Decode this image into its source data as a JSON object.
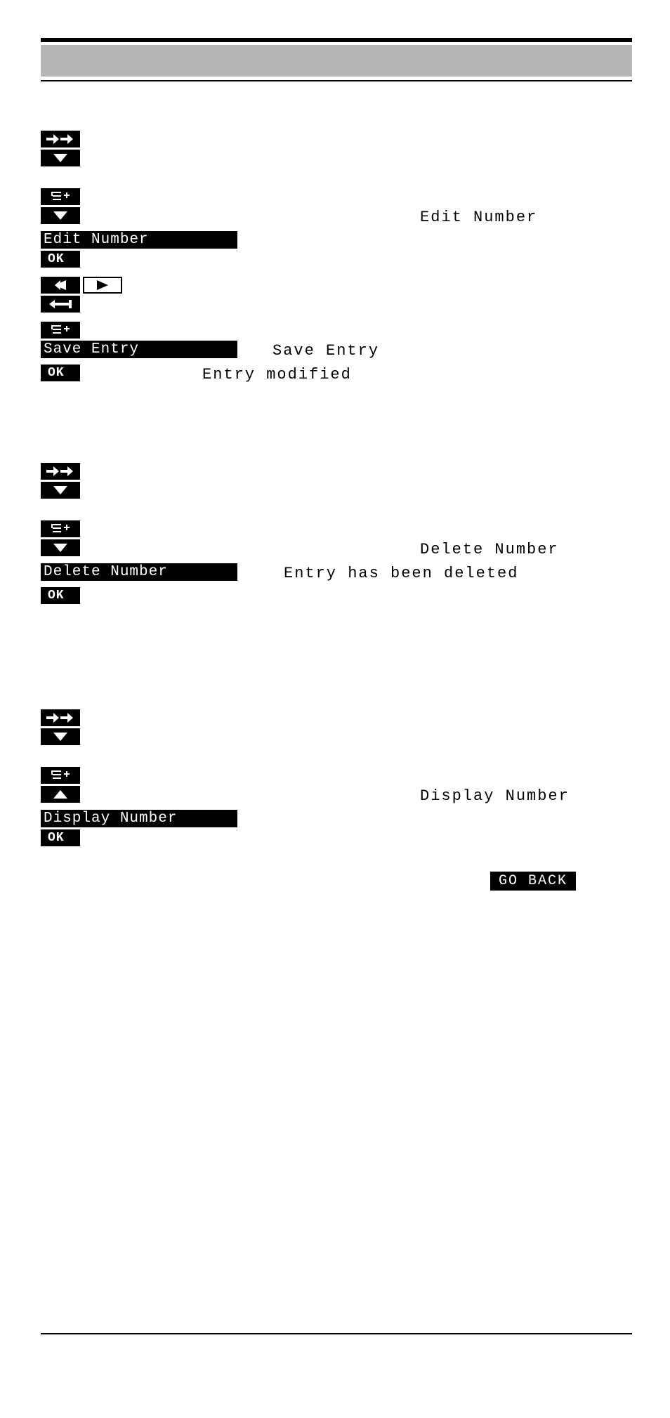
{
  "keys": {
    "ok": "OK",
    "go_back": "GO BACK"
  },
  "section1": {
    "menu_edit": "Edit Number",
    "display_edit": "Edit Number",
    "menu_save": "Save Entry",
    "display_save": "Save Entry",
    "display_modified": "Entry modified"
  },
  "section2": {
    "menu_delete": "Delete Number",
    "display_delete": "Delete Number",
    "display_deleted": "Entry has been deleted"
  },
  "section3": {
    "menu_display": "Display Number",
    "display_display": "Display Number"
  }
}
